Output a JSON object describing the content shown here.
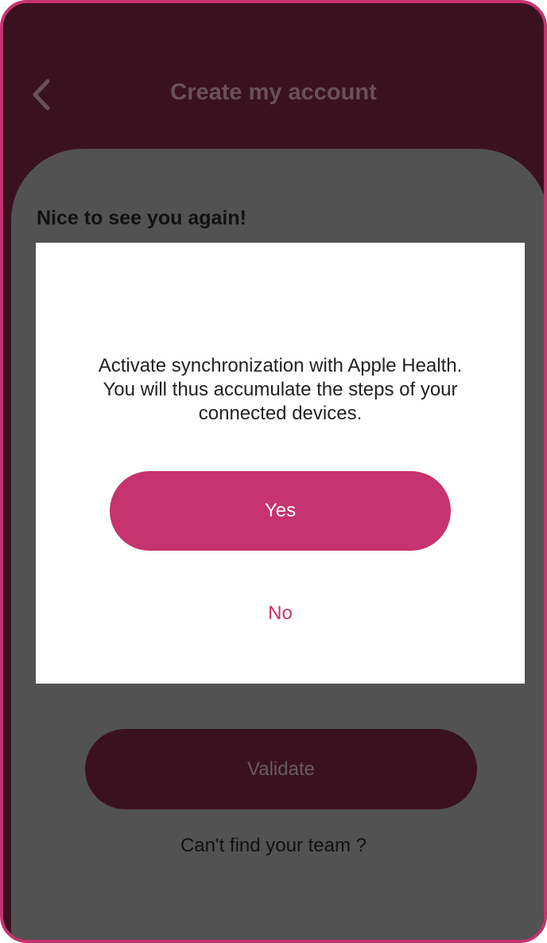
{
  "header": {
    "back_icon": "chevron-left-icon",
    "title": "Create my account"
  },
  "form": {
    "welcome": "Nice to see you again!",
    "validate_label": "Validate",
    "team_link": "Can't find your team ?"
  },
  "dialog": {
    "message": "Activate synchronization with Apple Health.\nYou will thus accumulate the steps of your\nconnected devices.",
    "yes_label": "Yes",
    "no_label": "No"
  },
  "colors": {
    "accent": "#c6336e",
    "header_background": "#3a121f",
    "overlay_card": "#525252",
    "dialog_background": "#ffffff"
  }
}
